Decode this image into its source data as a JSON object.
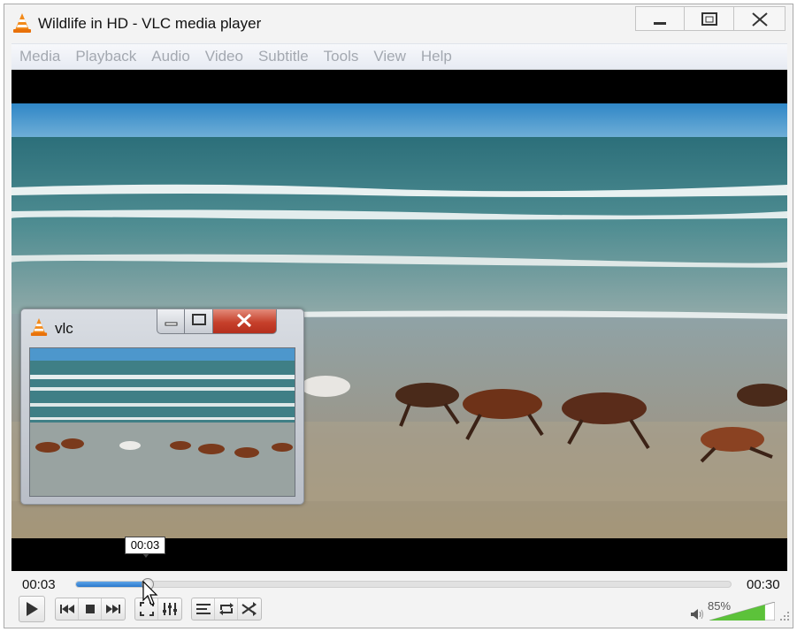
{
  "window": {
    "title": "Wildlife in HD - VLC media player"
  },
  "menu": [
    "Media",
    "Playback",
    "Audio",
    "Video",
    "Subtitle",
    "Tools",
    "View",
    "Help"
  ],
  "mini_window": {
    "title": "vlc"
  },
  "playback": {
    "current_time": "00:03",
    "total_time": "00:30",
    "hover_time": "00:03",
    "progress": 0.11
  },
  "volume": {
    "percent_label": "85%",
    "level": 0.85
  },
  "controls": [
    "play-icon",
    "previous-icon",
    "stop-icon",
    "next-icon",
    "fullscreen-icon",
    "extended-settings-icon",
    "playlist-icon",
    "loop-icon",
    "shuffle-icon"
  ],
  "colors": {
    "accent": "#2a78cc",
    "volume_fill": "#5cc23a",
    "close_red": "#c6402b"
  }
}
